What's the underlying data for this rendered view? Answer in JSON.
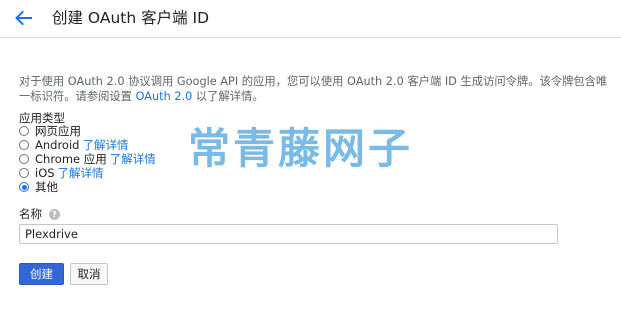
{
  "header": {
    "title": "创建 OAuth 客户端 ID",
    "back_icon": "arrow-back-icon",
    "accent": "#1a73e8"
  },
  "description": {
    "text_before": "对于使用 OAuth 2.0 协议调用 Google API 的应用，您可以使用 OAuth 2.0 客户端 ID 生成访问令牌。该令牌包含唯一标识符。请参阅设置 ",
    "link": "OAuth 2.0",
    "text_after": " 以了解详情。"
  },
  "app_type": {
    "label": "应用类型",
    "options": [
      {
        "label": "网页应用",
        "link": "",
        "checked": false
      },
      {
        "label": "Android",
        "link": "了解详情",
        "checked": false
      },
      {
        "label": "Chrome 应用",
        "link": "了解详情",
        "checked": false
      },
      {
        "label": "iOS",
        "link": "了解详情",
        "checked": false
      },
      {
        "label": "其他",
        "link": "",
        "checked": true
      }
    ]
  },
  "watermark": {
    "text": "常青藤网子"
  },
  "name_field": {
    "label": "名称",
    "help_icon": "help-icon",
    "value": "Plexdrive"
  },
  "buttons": {
    "create": "创建",
    "cancel": "取消",
    "primary_color": "#3367d6"
  }
}
